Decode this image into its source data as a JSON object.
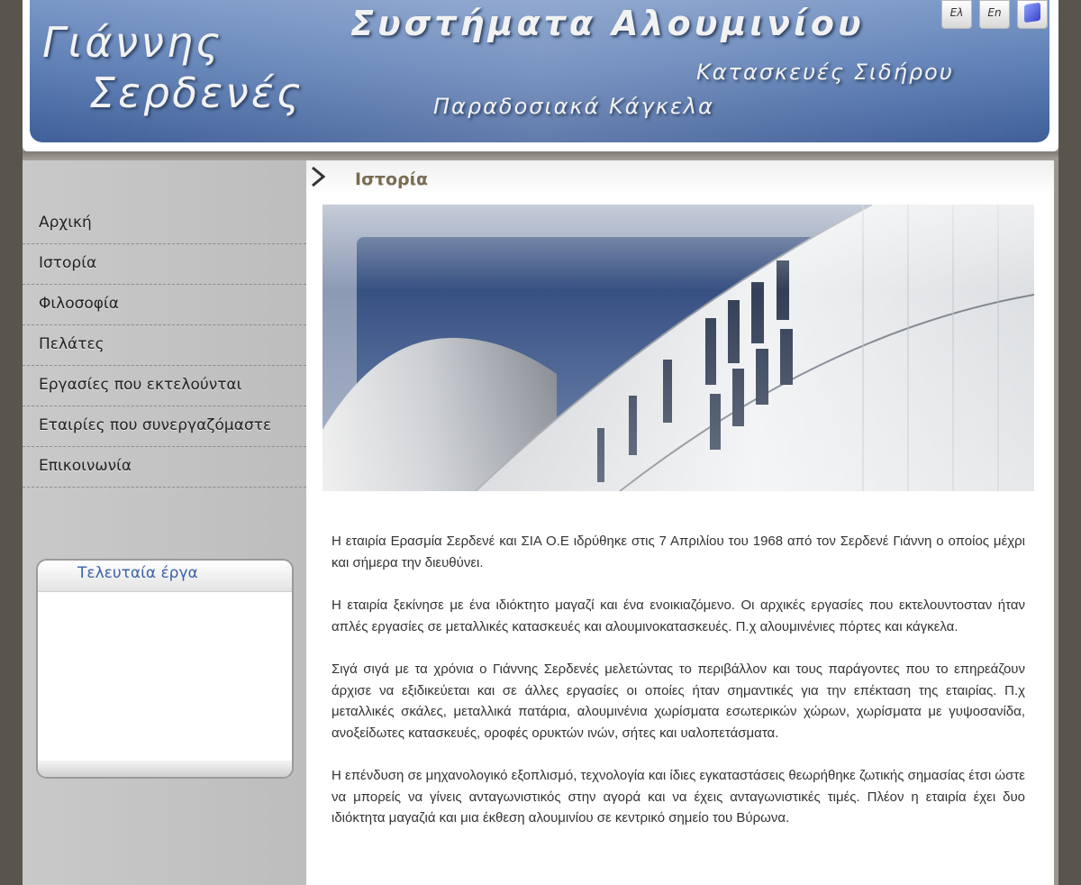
{
  "header": {
    "name_first": "Γιάννης",
    "name_last": "Σερδενές",
    "tagline_aluminium": "Συστήματα Αλουμινίου",
    "tagline_iron": "Κατασκευές Σιδήρου",
    "tagline_railings": "Παραδοσιακά Κάγκελα",
    "lang_el": "Ελ",
    "lang_en": "En",
    "lang_third_icon": "cube-icon"
  },
  "sidebar": {
    "menu": [
      {
        "label": "Αρχική"
      },
      {
        "label": "Ιστορία"
      },
      {
        "label": "Φιλοσοφία"
      },
      {
        "label": "Πελάτες"
      },
      {
        "label": "Εργασίες που εκτελούνται"
      },
      {
        "label": "Εταιρίες που συνεργαζόμαστε"
      },
      {
        "label": "Επικοινωνία"
      }
    ],
    "latest_works_title": "Τελευταία έργα"
  },
  "main": {
    "section_title": "Ιστορία",
    "paragraphs": [
      "Η εταιρία Ερασμία Σερδενέ και ΣΙΑ Ο.Ε ιδρύθηκε στις  7 Απριλίου του 1968 από τον Σερδενέ Γιάννη ο οποίος μέχρι και σήμερα την διευθύνει.",
      "Η εταιρία ξεκίνησε με ένα ιδιόκτητο μαγαζί και ένα ενοικιαζόμενο. Οι αρχικές εργασίες που εκτελουντοσταν ήταν απλές εργασίες σε μεταλλικές κατασκευές και αλουμινοκατασκευές. Π.χ αλουμινένιες πόρτες και κάγκελα.",
      "Σιγά σιγά με τα χρόνια ο Γιάννης Σερδενές μελετώντας το περιβάλλον και τους παράγοντες που το επηρεάζουν άρχισε να εξιδικεύεται και σε άλλες εργασίες οι οποίες ήταν σημαντικές για την επέκταση της εταιρίας. Π.χ μεταλλικές σκάλες, μεταλλικά πατάρια, αλουμινένια χωρίσματα εσωτερικών χώρων, χωρίσματα με γυψοσανίδα, ανοξείδωτες κατασκευές, οροφές ορυκτών ινών, σήτες  και υαλοπετάσματα.",
      "Η επένδυση σε μηχανολογικό εξοπλισμό,  τεχνολογία και ίδιες εγκαταστάσεις  θεωρήθηκε ζωτικής σημασίας έτσι ώστε να μπορείς να γίνεις ανταγωνιστικός στην αγορά και να έχεις ανταγωνιστικές τιμές. Πλέον η εταιρία έχει δυο ιδιόκτητα μαγαζιά και μια έκθεση αλουμινίου σε κεντρικό σημείο του Βύρωνα."
    ]
  }
}
